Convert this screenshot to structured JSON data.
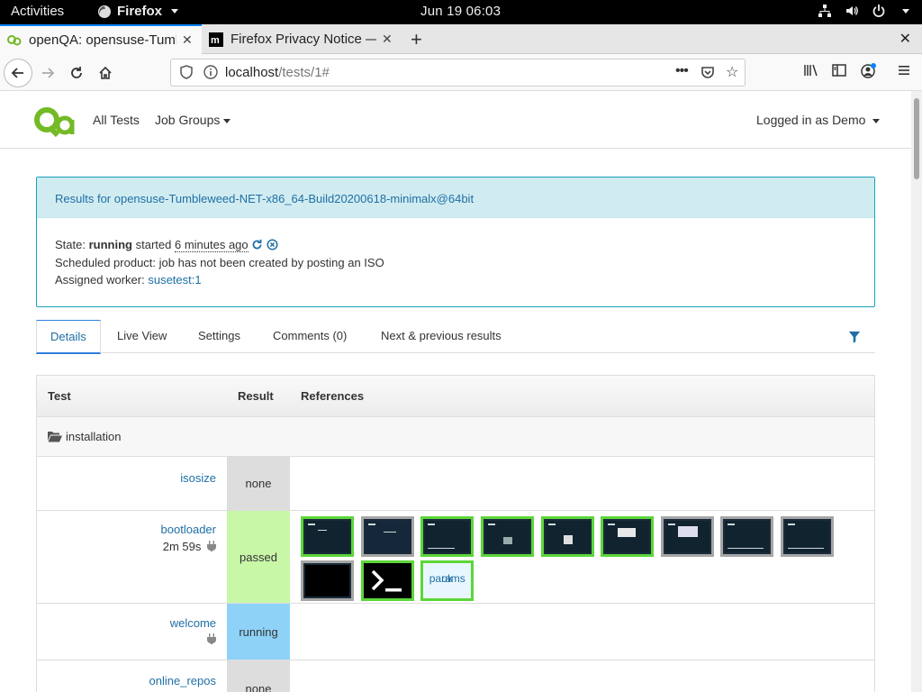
{
  "topbar": {
    "activities": "Activities",
    "app": "Firefox",
    "clock": "Jun 19  06:03"
  },
  "browser": {
    "tabs": [
      {
        "title": "openQA: opensuse-Tumb",
        "icon": "openqa-icon"
      },
      {
        "title": "Firefox Privacy Notice —",
        "icon": "mozilla-icon"
      }
    ],
    "url_host": "localhost",
    "url_path": "/tests/1#"
  },
  "site": {
    "nav_all_tests": "All Tests",
    "nav_job_groups": "Job Groups",
    "user": "Logged in as Demo"
  },
  "result": {
    "heading": "Results for opensuse-Tumbleweed-NET-x86_64-Build20200618-minimalx@64bit",
    "state_label": "State:",
    "state_value": "running",
    "started_label": "started",
    "started_value": "6 minutes ago",
    "scheduled": "Scheduled product: job has not been created by posting an ISO",
    "worker_label": "Assigned worker:",
    "worker_value": "susetest:1"
  },
  "page_tabs": [
    "Details",
    "Live View",
    "Settings",
    "Comments (0)",
    "Next & previous results"
  ],
  "table": {
    "headers": {
      "test": "Test",
      "result": "Result",
      "references": "References"
    },
    "group": "installation",
    "rows": [
      {
        "name": "isosize",
        "time": "",
        "result": "none"
      },
      {
        "name": "bootloader",
        "time": "2m 59s",
        "result": "passed"
      },
      {
        "name": "welcome",
        "time": "",
        "result": "running"
      },
      {
        "name": "online_repos",
        "time": "",
        "result": "none"
      }
    ],
    "params": {
      "line1": "params",
      "line2": "ok"
    }
  },
  "colors": {
    "accent": "#1f6fa5",
    "passed": "#c8f7a8",
    "running": "#8ed2f8",
    "none": "#dddddd",
    "thumb_ok_border": "#5cd63a"
  }
}
